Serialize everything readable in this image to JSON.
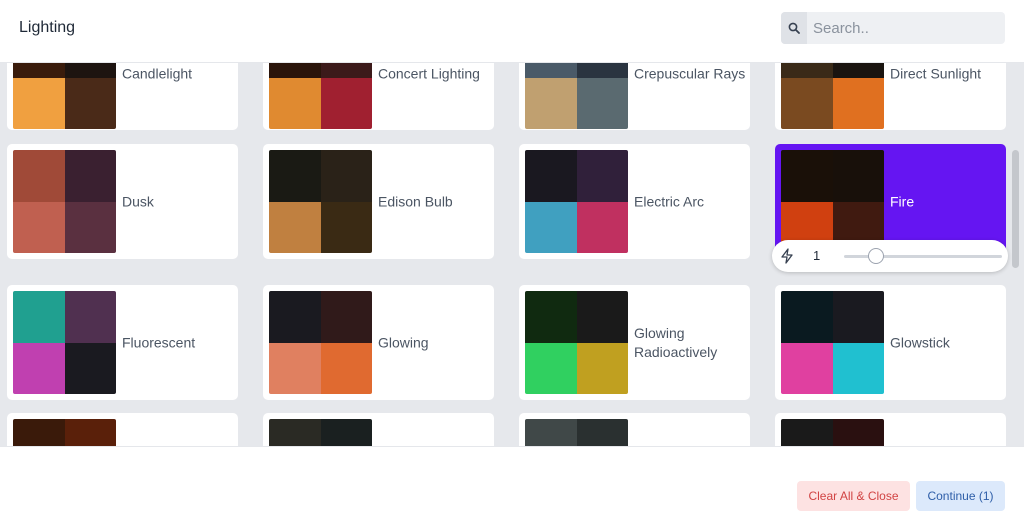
{
  "header": {
    "title": "Lighting"
  },
  "search": {
    "placeholder": "Search..",
    "icon": "search-icon"
  },
  "cards": [
    {
      "label": "Candlelight",
      "colors": [
        "#3a1c0c",
        "#1d1410",
        "#f0a040",
        "#4a2a18"
      ]
    },
    {
      "label": "Concert Lighting",
      "colors": [
        "#2a140a",
        "#3c1a1a",
        "#e08a30",
        "#a02030"
      ]
    },
    {
      "label": "Crepuscular Rays",
      "colors": [
        "#4a5a68",
        "#2a3440",
        "#c0a070",
        "#5a6a70"
      ]
    },
    {
      "label": "Direct Sunlight",
      "colors": [
        "#3a2a18",
        "#1a1410",
        "#7a4a20",
        "#e07020"
      ]
    },
    {
      "label": "Dusk",
      "colors": [
        "#a04a38",
        "#3a2030",
        "#c06050",
        "#5a3040"
      ]
    },
    {
      "label": "Edison Bulb",
      "colors": [
        "#1a1a14",
        "#2a2218",
        "#c08040",
        "#3a2a14"
      ]
    },
    {
      "label": "Electric Arc",
      "colors": [
        "#1a1820",
        "#30203a",
        "#40a0c0",
        "#c03060"
      ]
    },
    {
      "label": "Fire",
      "colors": [
        "#1a1008",
        "#18100a",
        "#d04010",
        "#401a10"
      ],
      "selected": true
    },
    {
      "label": "Fluorescent",
      "colors": [
        "#20a090",
        "#503050",
        "#c040b0",
        "#1a1a20"
      ]
    },
    {
      "label": "Glowing",
      "colors": [
        "#1a1a20",
        "#301a1a",
        "#e08060",
        "#e06a30"
      ]
    },
    {
      "label": "Glowing\nRadioactively",
      "colors": [
        "#102a10",
        "#1a1a1a",
        "#30d060",
        "#c0a020"
      ]
    },
    {
      "label": "Glowstick",
      "colors": [
        "#0a1a20",
        "#1a1a20",
        "#e040a0",
        "#20c0d0"
      ]
    },
    {
      "label": "",
      "colors": [
        "#3a1a0a",
        "#5a200a",
        "#e06020",
        "#2a1010"
      ]
    },
    {
      "label": "",
      "colors": [
        "#2a2a24",
        "#1a2020",
        "#d0c0a0",
        "#202828"
      ]
    },
    {
      "label": "",
      "colors": [
        "#404848",
        "#2a3030",
        "#a0a0a0",
        "#303838"
      ]
    },
    {
      "label": "",
      "colors": [
        "#1a1a1a",
        "#2a1010",
        "#e06040",
        "#c04020"
      ]
    }
  ],
  "intensity": {
    "value": "1",
    "level": 0.2,
    "icon": "bolt-icon"
  },
  "footer": {
    "clear_label": "Clear All & Close",
    "continue_label": "Continue (1)"
  },
  "accent": "#6515f2"
}
